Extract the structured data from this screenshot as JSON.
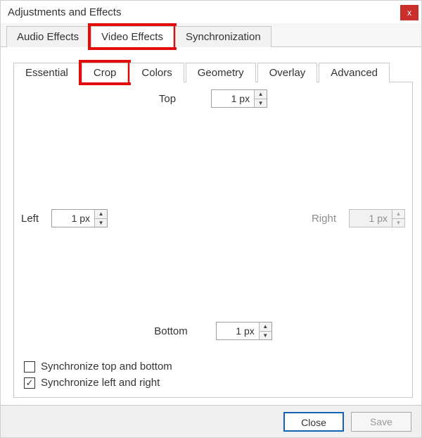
{
  "window": {
    "title": "Adjustments and Effects"
  },
  "tabs_primary": {
    "audio": "Audio Effects",
    "video": "Video Effects",
    "sync": "Synchronization",
    "selected": "video"
  },
  "tabs_secondary": {
    "essential": "Essential",
    "crop": "Crop",
    "colors": "Colors",
    "geometry": "Geometry",
    "overlay": "Overlay",
    "advanced": "Advanced",
    "selected": "crop"
  },
  "crop": {
    "top_label": "Top",
    "top_value": "1 px",
    "left_label": "Left",
    "left_value": "1 px",
    "right_label": "Right",
    "right_value": "1 px",
    "bottom_label": "Bottom",
    "bottom_value": "1 px",
    "sync_tb_label": "Synchronize top and bottom",
    "sync_tb_checked": false,
    "sync_lr_label": "Synchronize left and right",
    "sync_lr_checked": true
  },
  "footer": {
    "close": "Close",
    "save": "Save"
  },
  "icons": {
    "close_x": "x",
    "up": "▲",
    "down": "▼",
    "check": "✓"
  }
}
